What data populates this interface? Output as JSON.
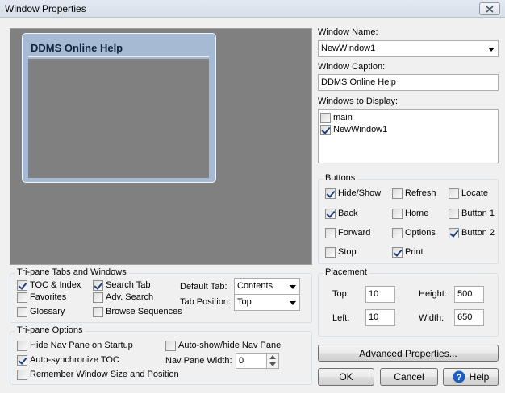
{
  "window": {
    "title": "Window Properties"
  },
  "preview": {
    "caption": "DDMS Online Help"
  },
  "window_name": {
    "label": "Window Name:",
    "value": "NewWindow1"
  },
  "window_caption": {
    "label": "Window Caption:",
    "value": "DDMS Online Help"
  },
  "windows_to_display": {
    "label": "Windows to Display:",
    "items": [
      {
        "label": "main",
        "checked": false
      },
      {
        "label": "NewWindow1",
        "checked": true
      }
    ]
  },
  "buttons_group": {
    "title": "Buttons",
    "items": [
      {
        "label": "Hide/Show",
        "checked": true
      },
      {
        "label": "Refresh",
        "checked": false
      },
      {
        "label": "Locate",
        "checked": false
      },
      {
        "label": "Back",
        "checked": true
      },
      {
        "label": "Home",
        "checked": false
      },
      {
        "label": "Button 1",
        "checked": false
      },
      {
        "label": "Forward",
        "checked": false
      },
      {
        "label": "Options",
        "checked": false
      },
      {
        "label": "Button 2",
        "checked": true
      },
      {
        "label": "Stop",
        "checked": false
      },
      {
        "label": "Print",
        "checked": true
      }
    ]
  },
  "placement": {
    "title": "Placement",
    "top_label": "Top:",
    "top_value": "10",
    "left_label": "Left:",
    "left_value": "10",
    "height_label": "Height:",
    "height_value": "500",
    "width_label": "Width:",
    "width_value": "650"
  },
  "tabs_group": {
    "title": "Tri-pane Tabs and Windows",
    "toc": {
      "label": "TOC & Index",
      "checked": true
    },
    "favorites": {
      "label": "Favorites",
      "checked": false
    },
    "glossary": {
      "label": "Glossary",
      "checked": false
    },
    "search_tab": {
      "label": "Search Tab",
      "checked": true
    },
    "adv_search": {
      "label": "Adv. Search",
      "checked": false
    },
    "browse_sequences": {
      "label": "Browse Sequences",
      "checked": false
    },
    "default_tab_label": "Default Tab:",
    "default_tab_value": "Contents",
    "tab_position_label": "Tab Position:",
    "tab_position_value": "Top"
  },
  "options_group": {
    "title": "Tri-pane Options",
    "hide_nav": {
      "label": "Hide Nav Pane on Startup",
      "checked": false
    },
    "auto_sync": {
      "label": "Auto-synchronize TOC",
      "checked": true
    },
    "remember": {
      "label": "Remember Window Size and Position",
      "checked": false
    },
    "auto_show": {
      "label": "Auto-show/hide Nav Pane",
      "checked": false
    },
    "nav_width_label": "Nav Pane Width:",
    "nav_width_value": "0"
  },
  "actions": {
    "advanced": "Advanced Properties...",
    "ok": "OK",
    "cancel": "Cancel",
    "help": "Help"
  }
}
